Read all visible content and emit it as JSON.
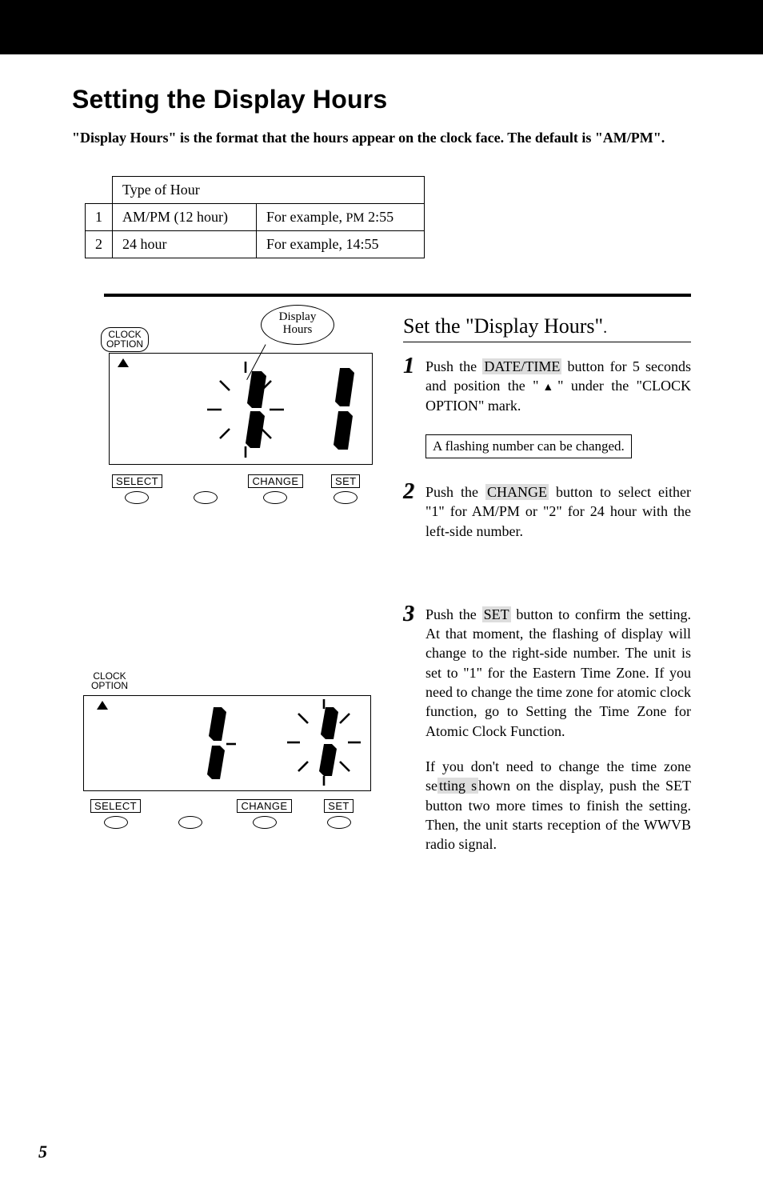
{
  "pageNumber": "5",
  "heading": "Setting the Display Hours",
  "intro": "\"Display Hours\" is the format that the hours appear on the clock face.  The default is \"AM/PM\".",
  "table": {
    "header": "Type of Hour",
    "rows": [
      {
        "no": "1",
        "type": "AM/PM (12 hour)",
        "example_prefix": "For example, ",
        "example_pm": "PM",
        "example_time": " 2:55"
      },
      {
        "no": "2",
        "type": "24 hour",
        "example_prefix": "For example, ",
        "example_pm": "",
        "example_time": "14:55"
      }
    ]
  },
  "diagram": {
    "clockOptionLabel_line1": "CLOCK",
    "clockOptionLabel_line2": "OPTION",
    "calloutLabel_line1": "Display",
    "calloutLabel_line2": "Hours",
    "buttons": {
      "select": "SELECT",
      "change": "CHANGE",
      "set": "SET"
    },
    "digits_top_left": "1",
    "digits_top_right": "1",
    "digits_bottom_left": "1",
    "digits_bottom_right": "1"
  },
  "rightTitle": "Set the \"Display Hours\"",
  "steps": {
    "step1": {
      "num": "1",
      "part1": "Push the ",
      "hl": "DATE/TIME",
      "part2": " button for 5 seconds and position the \"",
      "triangle": "▲",
      "part3": "\" under the \"CLOCK OPTION\" mark."
    },
    "note1": "A flashing number can be changed.",
    "step2": {
      "num": "2",
      "part1": "Push the ",
      "hl": "CHANGE",
      "part2": " button to select either \"1\" for AM/PM or \"2\" for 24 hour with the left-side number."
    },
    "step3": {
      "num": "3",
      "part1": "Push the ",
      "hl": "SET",
      "part2": " button to confirm the setting.  At that moment, the flashing of display will change to the right-side number.  The unit is set to \"1\" for the Eastern Time Zone. If you need to change the time zone for atomic clock function, go to Setting the Time Zone for Atomic Clock Function."
    },
    "followup": {
      "part1": "If you don't need to change the time zone se",
      "hl": "tting s",
      "part2": "hown on the display, push the SET button two more times to finish the setting.  Then, the unit starts reception of the WWVB radio signal."
    }
  }
}
